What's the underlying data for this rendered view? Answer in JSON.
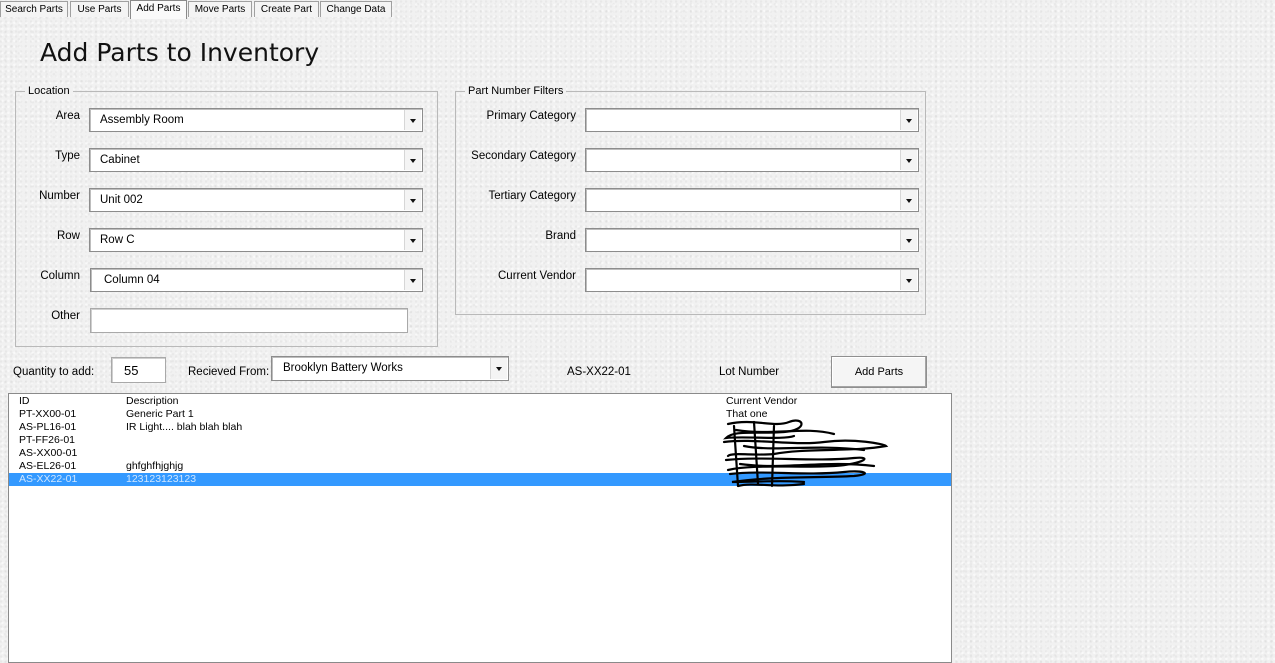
{
  "tabs": [
    {
      "label": "Search Parts",
      "active": false
    },
    {
      "label": "Use Parts",
      "active": false
    },
    {
      "label": "Add Parts",
      "active": true
    },
    {
      "label": "Move Parts",
      "active": false
    },
    {
      "label": "Create Part",
      "active": false
    },
    {
      "label": "Change Data",
      "active": false
    }
  ],
  "page_title": "Add Parts to Inventory",
  "location": {
    "legend": "Location",
    "area": {
      "label": "Area",
      "value": "Assembly Room"
    },
    "type": {
      "label": "Type",
      "value": "Cabinet"
    },
    "number": {
      "label": "Number",
      "value": "Unit 002"
    },
    "row": {
      "label": "Row",
      "value": "Row C"
    },
    "column": {
      "label": "Column",
      "value": "Column 04"
    },
    "other": {
      "label": "Other",
      "value": ""
    }
  },
  "filters": {
    "legend": "Part Number Filters",
    "primary": {
      "label": "Primary Category",
      "value": ""
    },
    "secondary": {
      "label": "Secondary Category",
      "value": ""
    },
    "tertiary": {
      "label": "Tertiary Category",
      "value": ""
    },
    "brand": {
      "label": "Brand",
      "value": ""
    },
    "vendor": {
      "label": "Current Vendor",
      "value": ""
    }
  },
  "entry": {
    "quantity_label": "Quantity to add:",
    "quantity_value": "55",
    "received_label": "Recieved From:",
    "received_value": "Brooklyn Battery Works",
    "selected_part": "AS-XX22-01",
    "lot_label": "Lot Number",
    "add_button": "Add Parts"
  },
  "list": {
    "headers": {
      "id": "ID",
      "description": "Description",
      "vendor": "Current Vendor"
    },
    "rows": [
      {
        "id": "PT-XX00-01",
        "description": "Generic Part 1",
        "vendor": "That one",
        "selected": false
      },
      {
        "id": "AS-PL16-01",
        "description": "IR Light.... blah blah blah",
        "vendor": "",
        "selected": false
      },
      {
        "id": "PT-FF26-01",
        "description": "",
        "vendor": "",
        "selected": false
      },
      {
        "id": "AS-XX00-01",
        "description": "",
        "vendor": "",
        "selected": false
      },
      {
        "id": "AS-EL26-01",
        "description": "ghfghfhjghjg",
        "vendor": "",
        "selected": false
      },
      {
        "id": "AS-XX22-01",
        "description": "123123123123",
        "vendor": "",
        "selected": true
      }
    ]
  },
  "colors": {
    "selection": "#3399ff",
    "redaction": "#000000"
  }
}
